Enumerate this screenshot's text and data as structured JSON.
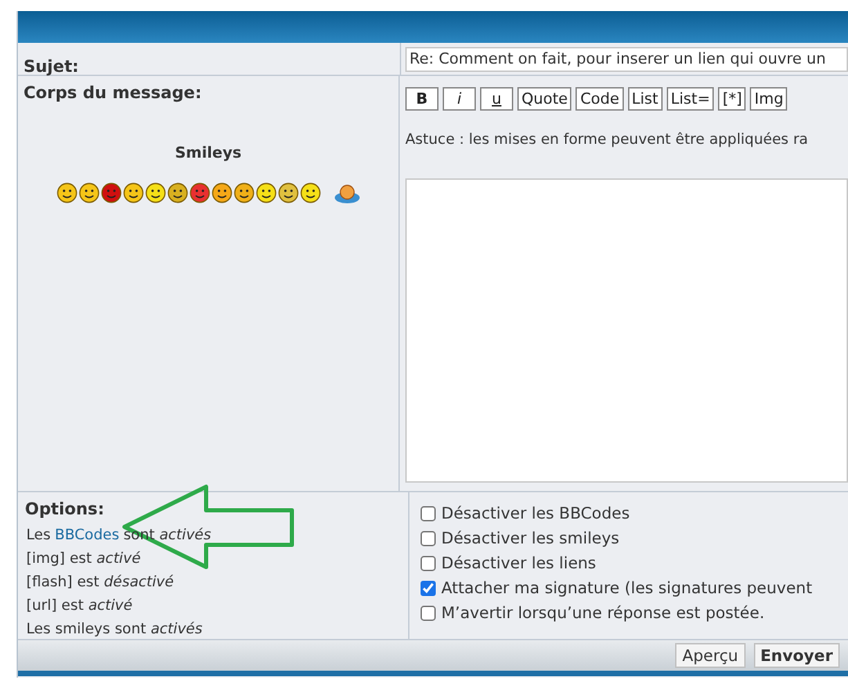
{
  "subject": {
    "label": "Sujet:",
    "value": "Re: Comment on fait, pour inserer un lien qui ouvre un"
  },
  "body": {
    "label": "Corps du message:",
    "smileys_title": "Smileys",
    "toolbar": [
      {
        "label": "B",
        "kind": "bold"
      },
      {
        "label": "i",
        "kind": "italic"
      },
      {
        "label": "u",
        "kind": "underline"
      },
      {
        "label": "Quote",
        "kind": "plain"
      },
      {
        "label": "Code",
        "kind": "plain"
      },
      {
        "label": "List",
        "kind": "plain"
      },
      {
        "label": "List=",
        "kind": "plain"
      },
      {
        "label": "[*]",
        "kind": "plain"
      },
      {
        "label": "Img",
        "kind": "plain"
      }
    ],
    "tip": "Astuce : les mises en forme peuvent être appliquées ra"
  },
  "options": {
    "label": "Options:",
    "lines": [
      {
        "kind": "link",
        "prefix": "Les",
        "link": "BBCodes",
        "suffix": "sont *activés*"
      },
      {
        "kind": "text",
        "text": "[img] est *activé*"
      },
      {
        "kind": "text",
        "text": "[flash] est *désactivé*"
      },
      {
        "kind": "text",
        "text": "[url] est *activé*"
      },
      {
        "kind": "text",
        "text": "Les smileys sont *activés*"
      }
    ],
    "checkboxes": [
      {
        "label": "Désactiver les BBCodes",
        "checked": false
      },
      {
        "label": "Désactiver les smileys",
        "checked": false
      },
      {
        "label": "Désactiver les liens",
        "checked": false
      },
      {
        "label": "Attacher ma signature (les signatures peuvent",
        "checked": true
      },
      {
        "label": "M’avertir lorsqu’une réponse est postée.",
        "checked": false
      }
    ]
  },
  "buttons": [
    {
      "label": "Aperçu",
      "primary": false
    },
    {
      "label": "Envoyer",
      "primary": true
    }
  ]
}
